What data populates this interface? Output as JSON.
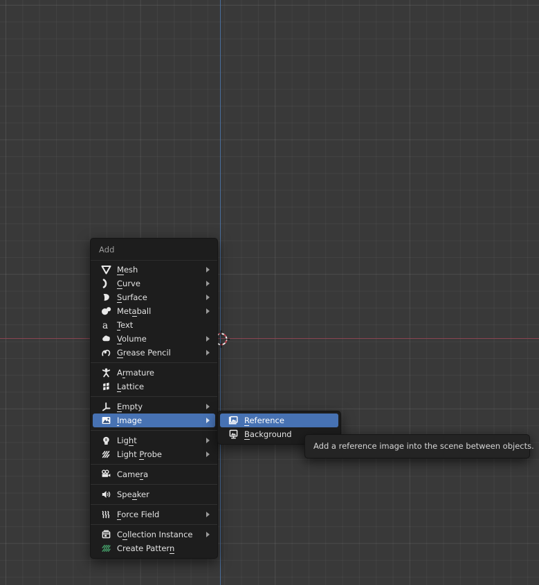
{
  "viewport": {
    "name": "3d-viewport",
    "background_color": "#393939",
    "grid_color": "#4a4a4a",
    "x_axis_color": "#8c4552",
    "y_axis_color": "#4a6f9e",
    "cursor_label": "3d-cursor"
  },
  "add_menu": {
    "title": "Add",
    "groups": [
      {
        "items": [
          {
            "label": "Mesh",
            "accel": "M",
            "icon": "mesh-icon",
            "submenu": true
          },
          {
            "label": "Curve",
            "accel": "C",
            "icon": "curve-icon",
            "submenu": true
          },
          {
            "label": "Surface",
            "accel": "S",
            "icon": "surface-icon",
            "submenu": true
          },
          {
            "label": "Metaball",
            "accel": "a",
            "icon": "metaball-icon",
            "submenu": true
          },
          {
            "label": "Text",
            "accel": "T",
            "icon": "text-icon",
            "submenu": false
          },
          {
            "label": "Volume",
            "accel": "V",
            "icon": "volume-icon",
            "submenu": true
          },
          {
            "label": "Grease Pencil",
            "accel": "G",
            "icon": "grease-pencil-icon",
            "submenu": true
          }
        ]
      },
      {
        "items": [
          {
            "label": "Armature",
            "accel": "r",
            "icon": "armature-icon",
            "submenu": false
          },
          {
            "label": "Lattice",
            "accel": "L",
            "icon": "lattice-icon",
            "submenu": false
          }
        ]
      },
      {
        "items": [
          {
            "label": "Empty",
            "accel": "E",
            "icon": "empty-icon",
            "submenu": true
          },
          {
            "label": "Image",
            "accel": "I",
            "icon": "image-icon",
            "submenu": true,
            "selected": true
          }
        ]
      },
      {
        "items": [
          {
            "label": "Light",
            "accel": "h",
            "icon": "light-icon",
            "submenu": true
          },
          {
            "label": "Light Probe",
            "accel": "P",
            "icon": "light-probe-icon",
            "submenu": true
          }
        ]
      },
      {
        "items": [
          {
            "label": "Camera",
            "accel": "r",
            "icon": "camera-icon",
            "submenu": false
          }
        ]
      },
      {
        "items": [
          {
            "label": "Speaker",
            "accel": "a",
            "icon": "speaker-icon",
            "submenu": false
          }
        ]
      },
      {
        "items": [
          {
            "label": "Force Field",
            "accel": "F",
            "icon": "force-field-icon",
            "submenu": true
          }
        ]
      },
      {
        "items": [
          {
            "label": "Collection Instance",
            "accel": "o",
            "icon": "collection-instance-icon",
            "submenu": true
          },
          {
            "label": "Create Pattern",
            "accel": "n",
            "icon": "create-pattern-icon",
            "submenu": false
          }
        ]
      }
    ],
    "labels": {
      "mesh": "Mesh",
      "curve": "Curve",
      "surface": "Surface",
      "metaball": "Metaball",
      "text": "Text",
      "volume": "Volume",
      "grease_pencil": "Grease Pencil",
      "armature": "Armature",
      "lattice": "Lattice",
      "empty": "Empty",
      "image": "Image",
      "light": "Light",
      "light_probe": "Light Probe",
      "camera": "Camera",
      "speaker": "Speaker",
      "force_field": "Force Field",
      "collection_instance": "Collection Instance",
      "create_pattern": "Create Pattern"
    }
  },
  "image_submenu": {
    "items": [
      {
        "label": "Reference",
        "icon": "image-reference-icon",
        "selected": true
      },
      {
        "label": "Background",
        "icon": "image-background-icon",
        "selected": false
      }
    ],
    "labels": {
      "reference": "Reference",
      "background": "Background"
    }
  },
  "tooltip": {
    "text": "Add a reference image into the scene between objects."
  },
  "colors": {
    "menu_background": "#1d1d1d",
    "menu_highlight": "#4772b3",
    "menu_text": "#e3e3e3",
    "tooltip_background": "#242424",
    "create_pattern_icon": "#45a06a"
  }
}
